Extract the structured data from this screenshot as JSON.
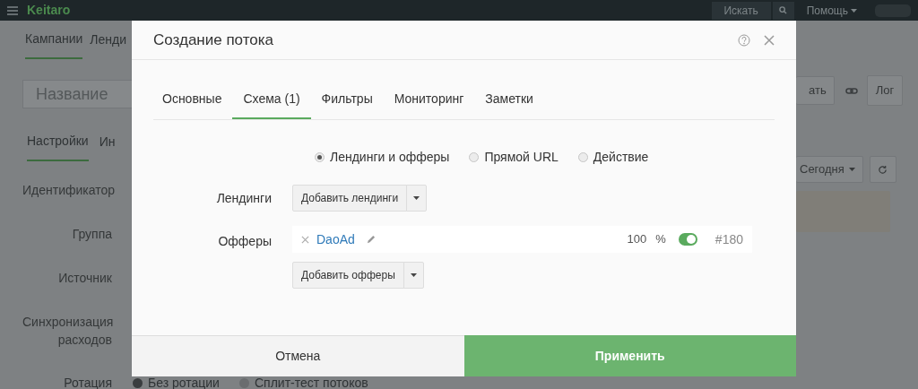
{
  "navbar": {
    "brand": "Keitaro",
    "search_button": "Искать",
    "help_menu": "Помощь"
  },
  "page": {
    "tabs": [
      {
        "label": "Кампании",
        "selected": true
      },
      {
        "label": "Ленди",
        "selected": false
      }
    ],
    "name_field": {
      "placeholder": "Название"
    },
    "save_button": "ать",
    "log_button": "Лог",
    "sub_tabs": [
      {
        "label": "Настройки",
        "selected": true
      },
      {
        "label": "Ин",
        "selected": false
      }
    ],
    "form_labels": [
      "Идентификатор",
      "Группа",
      "Источник",
      "Синхронизация расходов"
    ],
    "period_button": "Сегодня",
    "rotation": {
      "label": "Ротация",
      "options": [
        {
          "label": "Без ротации",
          "selected": true
        },
        {
          "label": "Сплит-тест потоков",
          "selected": false
        }
      ]
    }
  },
  "modal": {
    "title": "Создание потока",
    "tabs": [
      {
        "label": "Основные",
        "selected": false
      },
      {
        "label": "Схема (1)",
        "selected": true
      },
      {
        "label": "Фильтры",
        "selected": false
      },
      {
        "label": "Мониторинг",
        "selected": false
      },
      {
        "label": "Заметки",
        "selected": false
      }
    ],
    "schema_options": [
      {
        "label": "Лендинги и офферы",
        "selected": true
      },
      {
        "label": "Прямой URL",
        "selected": false
      },
      {
        "label": "Действие",
        "selected": false
      }
    ],
    "landings": {
      "label": "Лендинги",
      "add_button": "Добавить лендинги"
    },
    "offers": {
      "label": "Офферы",
      "items": [
        {
          "name": "DaoAd",
          "share": "100",
          "unit": "%",
          "on": true,
          "id": "#180"
        }
      ],
      "add_button": "Добавить офферы"
    },
    "buttons": {
      "cancel": "Отмена",
      "apply": "Применить"
    }
  }
}
